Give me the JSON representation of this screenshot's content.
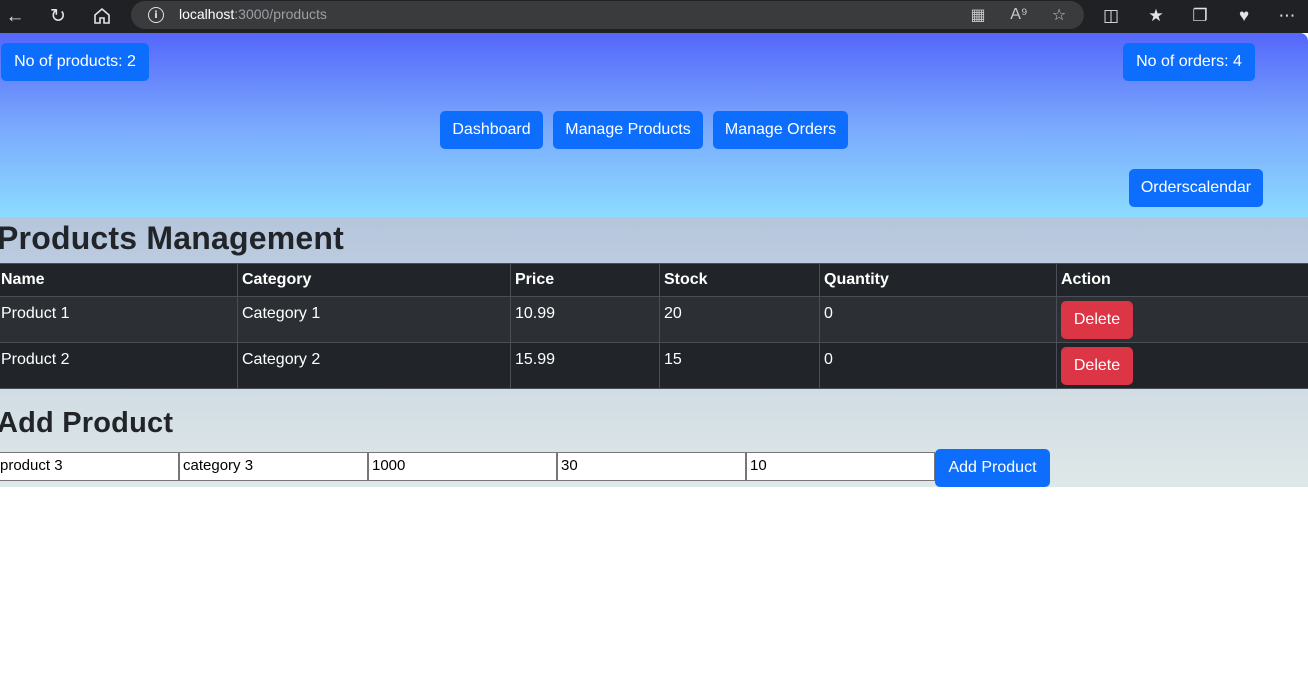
{
  "browser": {
    "url_host": "localhost",
    "url_path": ":3000/products"
  },
  "header": {
    "products_count_label": "No of products: 2",
    "orders_count_label": "No of orders: 4",
    "nav": {
      "dashboard": "Dashboard",
      "manage_products": "Manage Products",
      "manage_orders": "Manage Orders"
    },
    "orderscalendar": "Orderscalendar"
  },
  "products": {
    "title": "Products Management",
    "columns": [
      "Name",
      "Category",
      "Price",
      "Stock",
      "Quantity",
      "Action"
    ],
    "rows": [
      {
        "name": "Product 1",
        "category": "Category 1",
        "price": "10.99",
        "stock": "20",
        "quantity": "0",
        "action": "Delete"
      },
      {
        "name": "Product 2",
        "category": "Category 2",
        "price": "15.99",
        "stock": "15",
        "quantity": "0",
        "action": "Delete"
      }
    ]
  },
  "add_product": {
    "title": "Add Product",
    "name_value": "product 3",
    "category_value": "category 3",
    "price_value": "1000",
    "stock_value": "30",
    "quantity_value": "10",
    "submit_label": "Add Product"
  },
  "colors": {
    "primary": "#0d6efd",
    "danger": "#dc3545",
    "table_dark": "#212529"
  }
}
